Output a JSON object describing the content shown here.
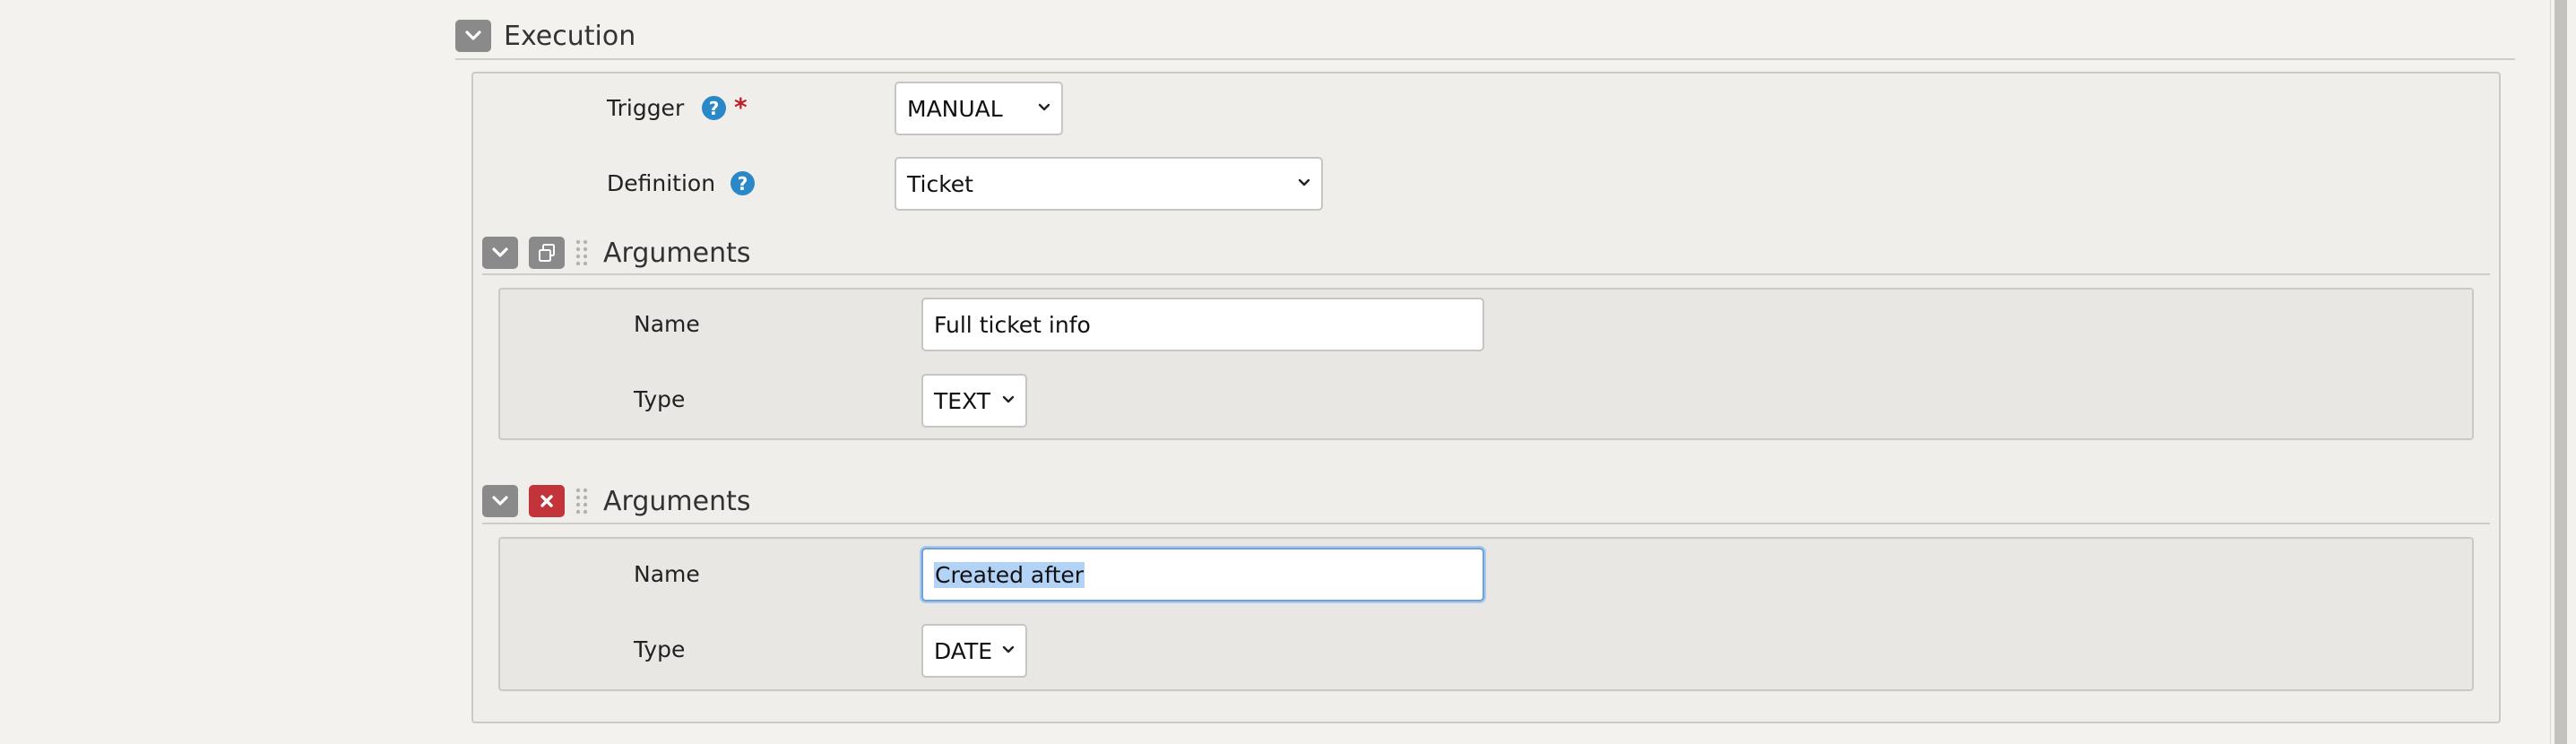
{
  "execution": {
    "title": "Execution",
    "trigger": {
      "label": "Trigger",
      "value": "MANUAL",
      "help": "?",
      "required_mark": "*"
    },
    "definition": {
      "label": "Definition",
      "value": "Ticket",
      "help": "?"
    }
  },
  "arguments": [
    {
      "title": "Arguments",
      "name_label": "Name",
      "name_value": "Full ticket info",
      "type_label": "Type",
      "type_value": "TEXT"
    },
    {
      "title": "Arguments",
      "name_label": "Name",
      "name_value": "Created after",
      "type_label": "Type",
      "type_value": "DATE"
    }
  ],
  "colors": {
    "background": "#f3f2ef",
    "toggle_button": "#8a8a8a",
    "remove_button": "#c2333a",
    "help_icon": "#2a88c8",
    "required": "#c0202a",
    "selection": "#b3d3f6"
  }
}
